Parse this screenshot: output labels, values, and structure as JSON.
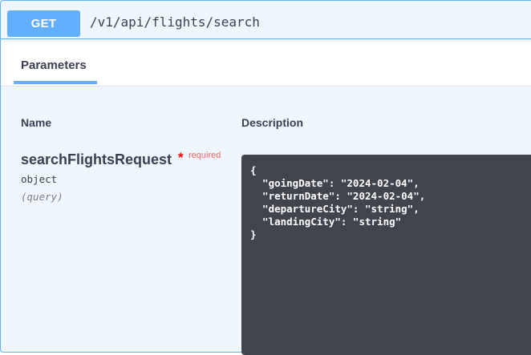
{
  "operation": {
    "method": "GET",
    "path": "/v1/api/flights/search"
  },
  "tabs": [
    {
      "label": "Parameters",
      "active": true
    }
  ],
  "table": {
    "columns": [
      "Name",
      "Description"
    ]
  },
  "parameter": {
    "name": "searchFlightsRequest",
    "required_star": "*",
    "required_label": "required",
    "type": "object",
    "in": "(query)",
    "value": "{\n  \"goingDate\": \"2024-02-04\",\n  \"returnDate\": \"2024-02-04\",\n  \"departureCity\": \"string\",\n  \"landingCity\": \"string\"\n}"
  },
  "colors": {
    "accent": "#61affe",
    "background": "#eff6fe",
    "textarea_bg": "#41444e",
    "required": "#f93e3e"
  }
}
